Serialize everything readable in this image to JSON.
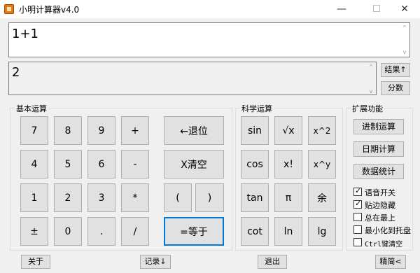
{
  "window": {
    "title": "小明计算器v4.0",
    "min_glyph": "—",
    "close_glyph": "✕"
  },
  "display": {
    "expression": "1+1",
    "result": "2",
    "scroll_up": "^",
    "scroll_down": "v"
  },
  "side_buttons": {
    "result_up": "结果↑",
    "fraction": "分数"
  },
  "basic": {
    "label": "基本运算",
    "keys": [
      "7",
      "8",
      "9",
      "+",
      "4",
      "5",
      "6",
      "-",
      "1",
      "2",
      "3",
      "*",
      "±",
      "0",
      ".",
      "/"
    ],
    "backspace": "←退位",
    "clear": "X清空",
    "lparen": "(",
    "rparen": ")",
    "equals": "=等于"
  },
  "science": {
    "label": "科学运算",
    "keys": [
      "sin",
      "√x",
      "x^2",
      "cos",
      "x!",
      "x^y",
      "tan",
      "π",
      "余",
      "cot",
      "ln",
      "lg"
    ]
  },
  "extended": {
    "label": "扩展功能",
    "buttons": [
      "进制运算",
      "日期计算",
      "数据统计"
    ],
    "options": [
      {
        "label": "语音开关",
        "checked": true
      },
      {
        "label": "贴边隐藏",
        "checked": true
      },
      {
        "label": "总在最上",
        "checked": false
      },
      {
        "label": "最小化到托盘",
        "checked": false
      },
      {
        "label": "Ctrl键清空",
        "checked": false
      }
    ]
  },
  "bottom": {
    "about": "关于",
    "history": "记录↓",
    "exit": "退出",
    "simple": "精简<"
  },
  "colors": {
    "focus_border": "#0078d7",
    "window_bg": "#f0f0f0",
    "button_bg": "#e1e1e1"
  }
}
